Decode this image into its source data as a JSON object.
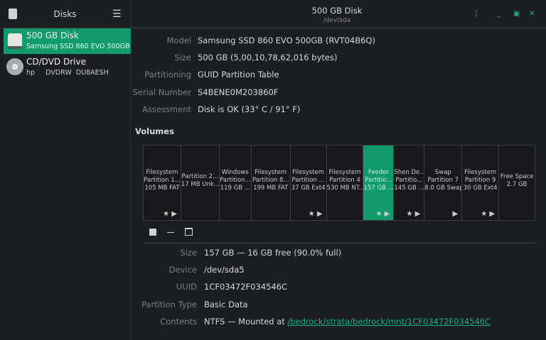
{
  "sidebar": {
    "title": "Disks",
    "disks": [
      {
        "name": "500 GB Disk",
        "sub": "Samsung SSD 860 EVO 500GB",
        "selected": true
      },
      {
        "name": "CD/DVD Drive",
        "sub": "hp     DVDRW  DU8AESH",
        "selected": false
      }
    ]
  },
  "header": {
    "title": "500 GB Disk",
    "subtitle": "/dev/sda"
  },
  "disk_info": [
    {
      "label": "Model",
      "value": "Samsung SSD 860 EVO 500GB (RVT04B6Q)"
    },
    {
      "label": "Size",
      "value": "500 GB (5,00,10,78,62,016 bytes)"
    },
    {
      "label": "Partitioning",
      "value": "GUID Partition Table"
    },
    {
      "label": "Serial Number",
      "value": "S4BENE0M203860F"
    },
    {
      "label": "Assessment",
      "value": "Disk is OK (33° C / 91° F)"
    }
  ],
  "volumes_heading": "Volumes",
  "volumes": [
    {
      "l1": "Filesystem",
      "l2": "Partition 1...",
      "l3": "105 MB FAT",
      "icons": "★ ▶"
    },
    {
      "l1": "",
      "l2": "Partition 2...",
      "l3": "17 MB Unk...",
      "icons": ""
    },
    {
      "l1": "Windows",
      "l2": "Partition...",
      "l3": "119 GB ...",
      "icons": ""
    },
    {
      "l1": "Filesystem",
      "l2": "Partition 8...",
      "l3": "199 MB FAT",
      "icons": ""
    },
    {
      "l1": "Filesystem",
      "l2": "Partition ...",
      "l3": "37 GB Ext4",
      "icons": "★ ▶"
    },
    {
      "l1": "Filesystem",
      "l2": "Partition 4",
      "l3": "530 MB NT...",
      "icons": ""
    },
    {
      "l1": "Feeder",
      "l2": "Partitio...",
      "l3": "157 GB ...",
      "icons": "★ ▶",
      "selected": true
    },
    {
      "l1": "Shen De...",
      "l2": "Partitio...",
      "l3": "145 GB ...",
      "icons": "★ ▶"
    },
    {
      "l1": "Swap",
      "l2": "Partition 7",
      "l3": "8.0 GB Swap",
      "icons": "▶"
    },
    {
      "l1": "Filesystem",
      "l2": "Partition 9",
      "l3": "30 GB Ext4",
      "icons": "★ ▶"
    },
    {
      "l1": "",
      "l2": "Free Space",
      "l3": "2.7 GB",
      "icons": ""
    }
  ],
  "volume_info": [
    {
      "label": "Size",
      "value": "157 GB — 16 GB free (90.0% full)"
    },
    {
      "label": "Device",
      "value": "/dev/sda5"
    },
    {
      "label": "UUID",
      "value": "1CF03472F034546C"
    },
    {
      "label": "Partition Type",
      "value": "Basic Data"
    },
    {
      "label": "Contents",
      "value": "NTFS — Mounted at ",
      "link": "/bedrock/strata/bedrock/mnt/1CF03472F034546C"
    }
  ],
  "colors": {
    "accent": "#119a6a",
    "link": "#19b07a"
  }
}
